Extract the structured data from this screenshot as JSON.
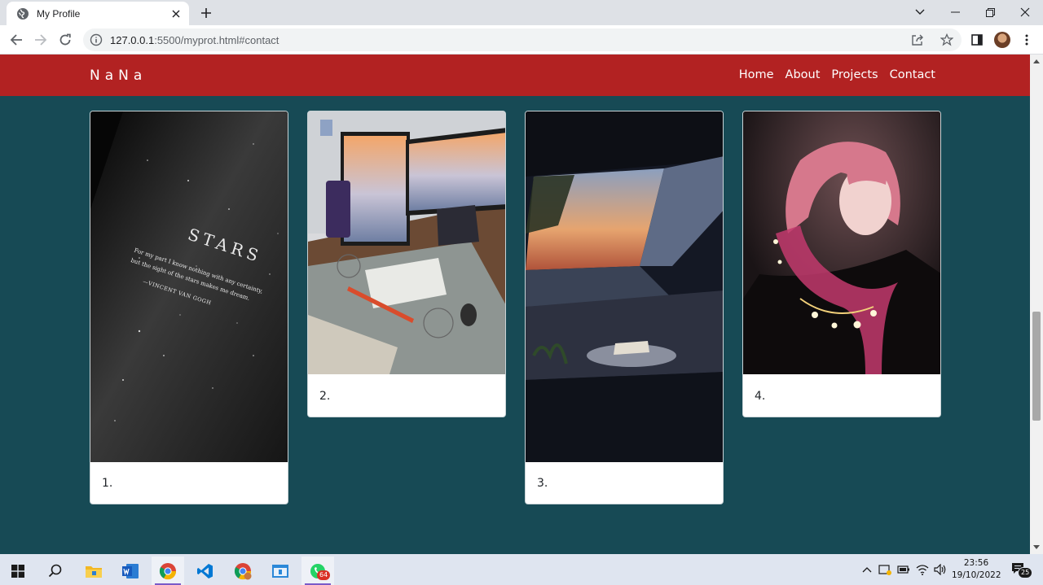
{
  "browser": {
    "tab_title": "My Profile",
    "url_host": "127.0.0.1",
    "url_rest": ":5500/myprot.html#contact"
  },
  "site": {
    "brand": "NaNa",
    "nav": [
      "Home",
      "About",
      "Projects",
      "Contact"
    ],
    "colors": {
      "nav_bg": "#b22222",
      "page_bg": "#174a55"
    }
  },
  "cards": [
    {
      "caption": "1.",
      "image": "stars book cover with Vincent van Gogh quote"
    },
    {
      "caption": "2.",
      "image": "desk setup with dual monitors and keyboard"
    },
    {
      "caption": "3.",
      "image": "attic window at sunset with book on bed"
    },
    {
      "caption": "4.",
      "image": "anime girl with pink hair and glowing flowers"
    }
  ],
  "stars_image": {
    "title": "STARS",
    "quote_line_1": "For my part I know nothing with any certainty,",
    "quote_line_2": "but the sight of the stars makes me dream.",
    "author": "—VINCENT VAN GOGH"
  },
  "taskbar": {
    "time": "23:56",
    "date": "19/10/2022",
    "whatsapp_badge": "64",
    "notification_count": "25"
  }
}
